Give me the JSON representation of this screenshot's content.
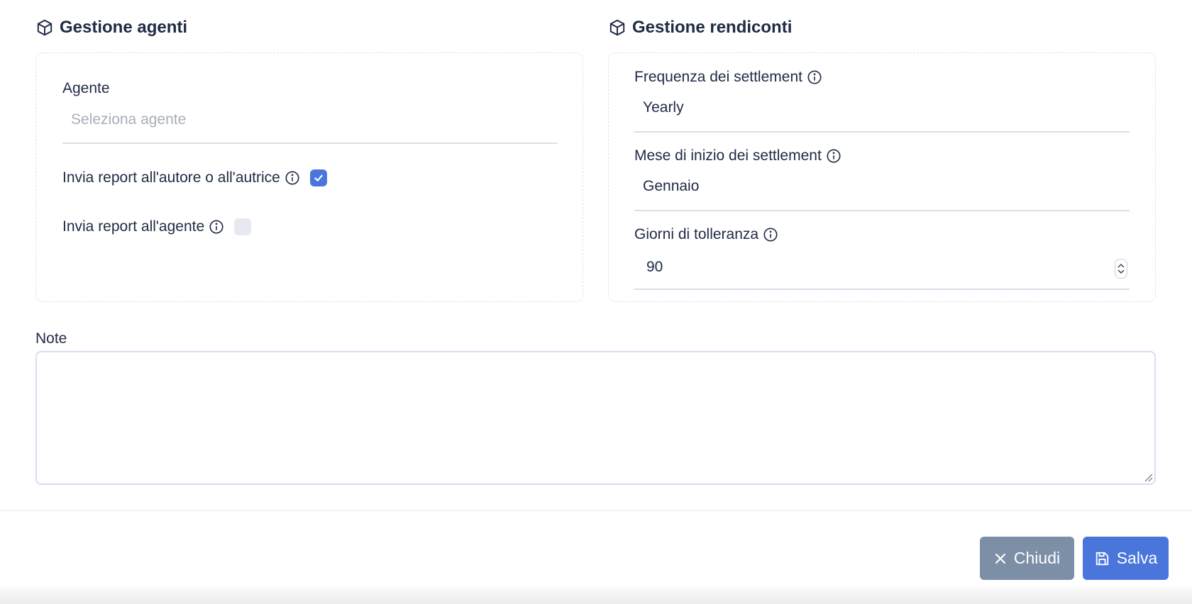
{
  "agents_section": {
    "title": "Gestione agenti",
    "agent_label": "Agente",
    "agent_placeholder": "Seleziona agente",
    "send_author_label": "Invia report all'autore o all'autrice",
    "send_author_checked": true,
    "send_agent_label": "Invia report all'agente",
    "send_agent_checked": false
  },
  "statements_section": {
    "title": "Gestione rendiconti",
    "frequency_label": "Frequenza dei settlement",
    "frequency_value": "Yearly",
    "start_month_label": "Mese di inizio dei settlement",
    "start_month_value": "Gennaio",
    "tolerance_label": "Giorni di tolleranza",
    "tolerance_value": "90"
  },
  "notes": {
    "label": "Note",
    "value": ""
  },
  "footer": {
    "close_label": "Chiudi",
    "save_label": "Salva"
  },
  "colors": {
    "primary": "#4a76dc",
    "secondary": "#7d8ea7",
    "text": "#1f2a44",
    "placeholder": "#a8aeb8"
  }
}
